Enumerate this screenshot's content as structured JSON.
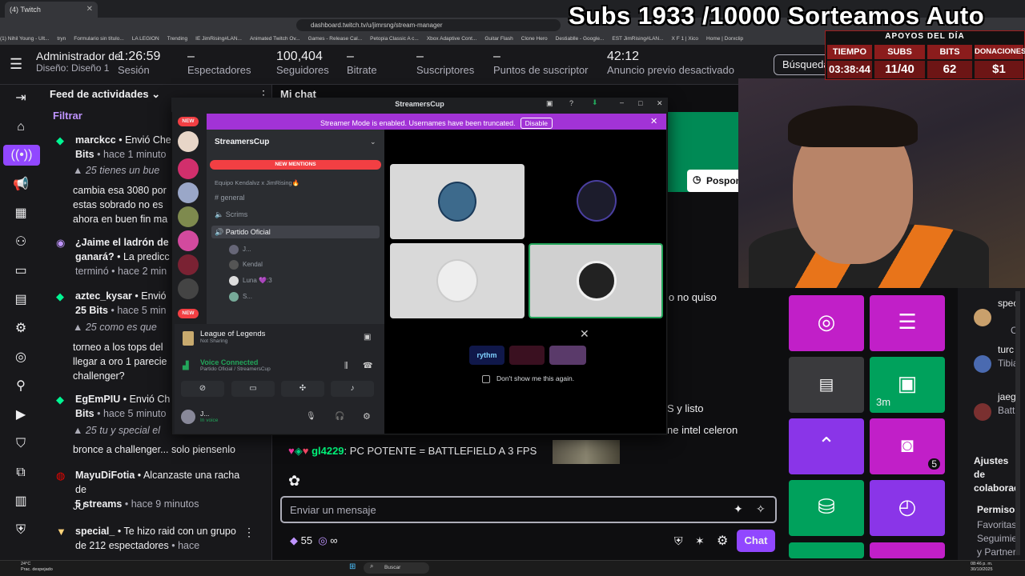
{
  "browser": {
    "tab_title": "(4) Twitch",
    "url": "dashboard.twitch.tv/u/jimrsng/stream-manager",
    "bookmarks": [
      "(1) Nihil Young - Ult...",
      "tryn",
      "Formulario sin título...",
      "LA LEGION",
      "Trending",
      "IE JimRising#LAN...",
      "Animated Twitch Ov...",
      "Games - Release Cal...",
      "Petopia Classic A c...",
      "Xbox Adaptive Cont...",
      "Guitar Flash",
      "Clone Hero",
      "Destiablle - Google...",
      "EST JimRising#LAN...",
      "X F 1 | Xico",
      "Home | Dorxclip"
    ]
  },
  "overlay": {
    "title": "Subs 1933 /10000 Sorteamos Auto",
    "support_title": "APOYOS DEL DÍA",
    "heads": [
      "TIEMPO",
      "SUBS",
      "BITS",
      "DONACIONES"
    ],
    "values": [
      "03:38:44",
      "11/40",
      "62",
      "$1"
    ]
  },
  "header": {
    "admin": "Administrador de",
    "design": "Diseño: Diseño 1",
    "session_value": "1:26:59",
    "session_label": "Sesión",
    "viewers_value": "–",
    "viewers_label": "Espectadores",
    "followers_value": "100,404",
    "followers_label": "Seguidores",
    "bitrate_value": "–",
    "bitrate_label": "Bitrate",
    "subs_value": "–",
    "subs_label": "Suscriptores",
    "points_value": "–",
    "points_label": "Puntos de suscriptor",
    "ad_value": "42:12",
    "ad_label": "Anuncio previo desactivado",
    "search": "Búsqueda"
  },
  "feed": {
    "title": "Feed de actividades",
    "filter": "Filtrar",
    "items": [
      {
        "user": "marckcc",
        "action": "Envió Che",
        "amount": "Bits",
        "time": "• hace 1 minuto",
        "msg": "25 tienes un bue",
        "extra": "cambia esa 3080 por estas sobrado no es ahora en buen fin ma"
      },
      {
        "user": "¿Jaime el ladrón de",
        "action": "ganará?",
        "amount": "La predicc",
        "time": "terminó • hace 2 min"
      },
      {
        "user": "aztec_kysar",
        "action": "Envió",
        "amount": "25 Bits",
        "time": "• hace 5 min",
        "msg": "25 como es que",
        "extra": "torneo a los tops del llegar a oro 1 parecie challenger?"
      },
      {
        "user": "EgEmPIU",
        "action": "Envió Ch",
        "amount": "Bits",
        "time": "• hace 5 minuto",
        "msg": "25 tu y special el",
        "extra": "bronce a challenger... solo piensenlo"
      },
      {
        "user": "MayuDiFotia",
        "action": "• Alcanzaste una racha de",
        "amount": "5 streams",
        "time": "• hace 9 minutos",
        "msg": "JU"
      },
      {
        "user": "special_",
        "action": "• Te hizo raid",
        "amount": "con un grupo de 212 espectadores",
        "time": "• hace"
      }
    ]
  },
  "chat": {
    "title": "Mi chat",
    "line_user": "gl4229",
    "line_text": ": PC POTENTE = BATTLEFIELD A 3 FPS",
    "frag1": "lo no quiso",
    "frag2": "S y listo",
    "frag3": "ne intel celeron",
    "posponer": "Pospone",
    "placeholder": "Enviar un mensaje",
    "points": "55",
    "infinity": "∞",
    "chat_button": "Chat"
  },
  "discord": {
    "window_title": "StreamersCup",
    "banner": "Streamer Mode is enabled. Usernames have been truncated.",
    "disable": "Disable",
    "server": "StreamersCup",
    "new_mentions": "NEW MENTIONS",
    "new_badge": "NEW",
    "category": "Equipo Kendalvz x JimRising🔥",
    "channels": [
      "general",
      "Scrims",
      "Partido Oficial"
    ],
    "voice_users": [
      "J...",
      "Kendal",
      "Luna 💜:3",
      "S..."
    ],
    "activity_title": "League of Legends",
    "activity_sub": "Not Sharing",
    "voice_status": "Voice Connected",
    "voice_channel": "Partido Oficial / StreamersCup",
    "user_name": "J...",
    "user_status": "In voice",
    "dont_show": "Don't show me this again.",
    "rythm": "rythm"
  },
  "quick_actions": {
    "timer_label": "3m",
    "badge": "5"
  },
  "right_column": {
    "users": [
      "spec",
      "turc",
      "jaeg"
    ],
    "user_subs": [
      "C",
      "Tibia",
      "Batt"
    ],
    "help_title": "Ajustes de colaborac",
    "perm_title": "Permisos",
    "perm_lines": [
      "Favoritas",
      "Seguimie",
      "y Partner"
    ]
  },
  "taskbar": {
    "search": "Buscar",
    "weather": "24°C",
    "weather_sub": "Prac. despejado",
    "time": "08:46 p. m.",
    "date": "30/10/2025"
  },
  "colors": {
    "accent": "#9147ff",
    "quick_magenta": "#c11fc8",
    "quick_purple": "#8a35e8",
    "quick_green": "#00a15c",
    "overlay_red": "#8b1c1c"
  }
}
